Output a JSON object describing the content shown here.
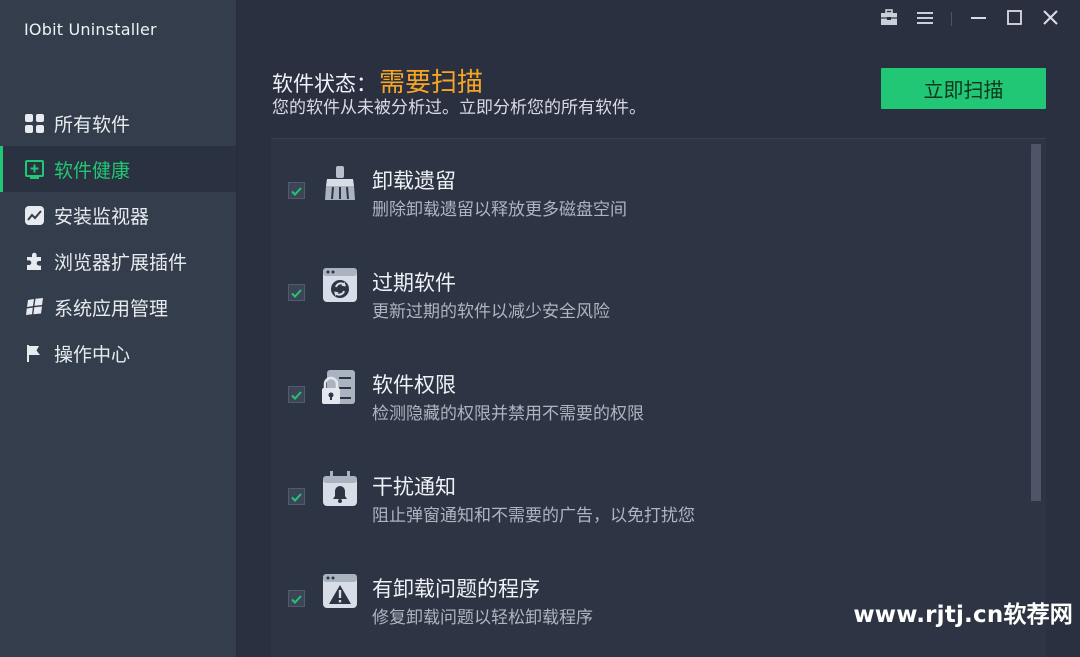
{
  "app": {
    "title": "IObit Uninstaller"
  },
  "window_controls": {
    "toolbox_icon": "toolbox-icon",
    "menu_icon": "menu-icon",
    "minimize_icon": "minimize-icon",
    "maximize_icon": "maximize-icon",
    "close_icon": "close-icon"
  },
  "sidebar": {
    "items": [
      {
        "label": "所有软件",
        "icon": "grid-icon",
        "active": false
      },
      {
        "label": "软件健康",
        "icon": "health-plus-icon",
        "active": true
      },
      {
        "label": "安装监视器",
        "icon": "monitor-chart-icon",
        "active": false
      },
      {
        "label": "浏览器扩展插件",
        "icon": "puzzle-icon",
        "active": false
      },
      {
        "label": "系统应用管理",
        "icon": "windows-icon",
        "active": false
      },
      {
        "label": "操作中心",
        "icon": "flag-icon",
        "active": false
      }
    ]
  },
  "header": {
    "status_label": "软件状态：",
    "status_value": "需要扫描",
    "description": "您的软件从未被分析过。立即分析您的所有软件。",
    "scan_button": "立即扫描"
  },
  "health_items": [
    {
      "title": "卸载遗留",
      "description": "删除卸载遗留以释放更多磁盘空间",
      "icon": "broom-icon",
      "checked": true
    },
    {
      "title": "过期软件",
      "description": "更新过期的软件以减少安全风险",
      "icon": "update-window-icon",
      "checked": true
    },
    {
      "title": "软件权限",
      "description": "检测隐藏的权限并禁用不需要的权限",
      "icon": "permission-lock-icon",
      "checked": true
    },
    {
      "title": "干扰通知",
      "description": "阻止弹窗通知和不需要的广告，以免打扰您",
      "icon": "notification-bell-icon",
      "checked": true
    },
    {
      "title": "有卸载问题的程序",
      "description": "修复卸载问题以轻松卸载程序",
      "icon": "warning-window-icon",
      "checked": true
    }
  ],
  "colors": {
    "accent": "#21c774",
    "warning": "#f6a623",
    "background": "#2a3040",
    "sidebar": "#343d4b"
  },
  "watermark": "www.rjtj.cn软荐网"
}
